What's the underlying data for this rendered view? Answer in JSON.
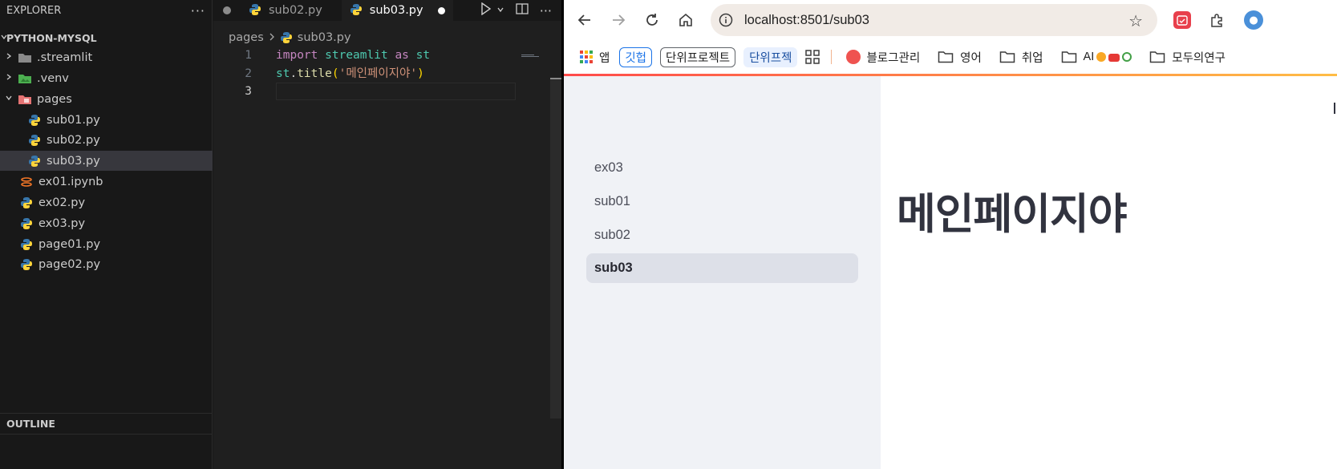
{
  "explorer": {
    "title": "EXPLORER",
    "project": "PYTHON-MYSQL",
    "items": [
      {
        "label": ".streamlit"
      },
      {
        "label": ".venv"
      },
      {
        "label": "pages"
      },
      {
        "label": "sub01.py"
      },
      {
        "label": "sub02.py"
      },
      {
        "label": "sub03.py"
      },
      {
        "label": "ex01.ipynb"
      },
      {
        "label": "ex02.py"
      },
      {
        "label": "ex03.py"
      },
      {
        "label": "page01.py"
      },
      {
        "label": "page02.py"
      }
    ],
    "outline": "OUTLINE"
  },
  "editor": {
    "tabs": [
      {
        "label": "sub02.py"
      },
      {
        "label": "sub03.py"
      }
    ],
    "breadcrumb": {
      "folder": "pages",
      "file": "sub03.py"
    },
    "line_numbers": [
      "1",
      "2",
      "3"
    ],
    "code": {
      "line1": {
        "kw_import": "import",
        "module": "streamlit",
        "kw_as": "as",
        "alias": "st"
      },
      "line2": {
        "obj": "st",
        "dot": ".",
        "fn": "title",
        "open": "(",
        "str": "'메인페이지야'",
        "close": ")"
      }
    }
  },
  "browser": {
    "url": "localhost:8501/sub03",
    "bookmarks": {
      "apps": "앱",
      "github": "깃헙",
      "unit_project": "단위프로젝트",
      "unit_project_short": "단위프젝",
      "blog": "블로그관리",
      "english": "영어",
      "job": "취업",
      "ai": "AI",
      "modu": "모두의연구"
    },
    "sidebar": {
      "items": [
        {
          "label": "ex03"
        },
        {
          "label": "sub01"
        },
        {
          "label": "sub02"
        },
        {
          "label": "sub03"
        }
      ]
    },
    "page_title": "메인페이지야"
  },
  "colors": {
    "vscode_bg": "#181818",
    "editor_bg": "#1f1f1f",
    "streamlit_sidebar": "#f0f2f6",
    "streamlit_accent": "#ff4b4b"
  }
}
